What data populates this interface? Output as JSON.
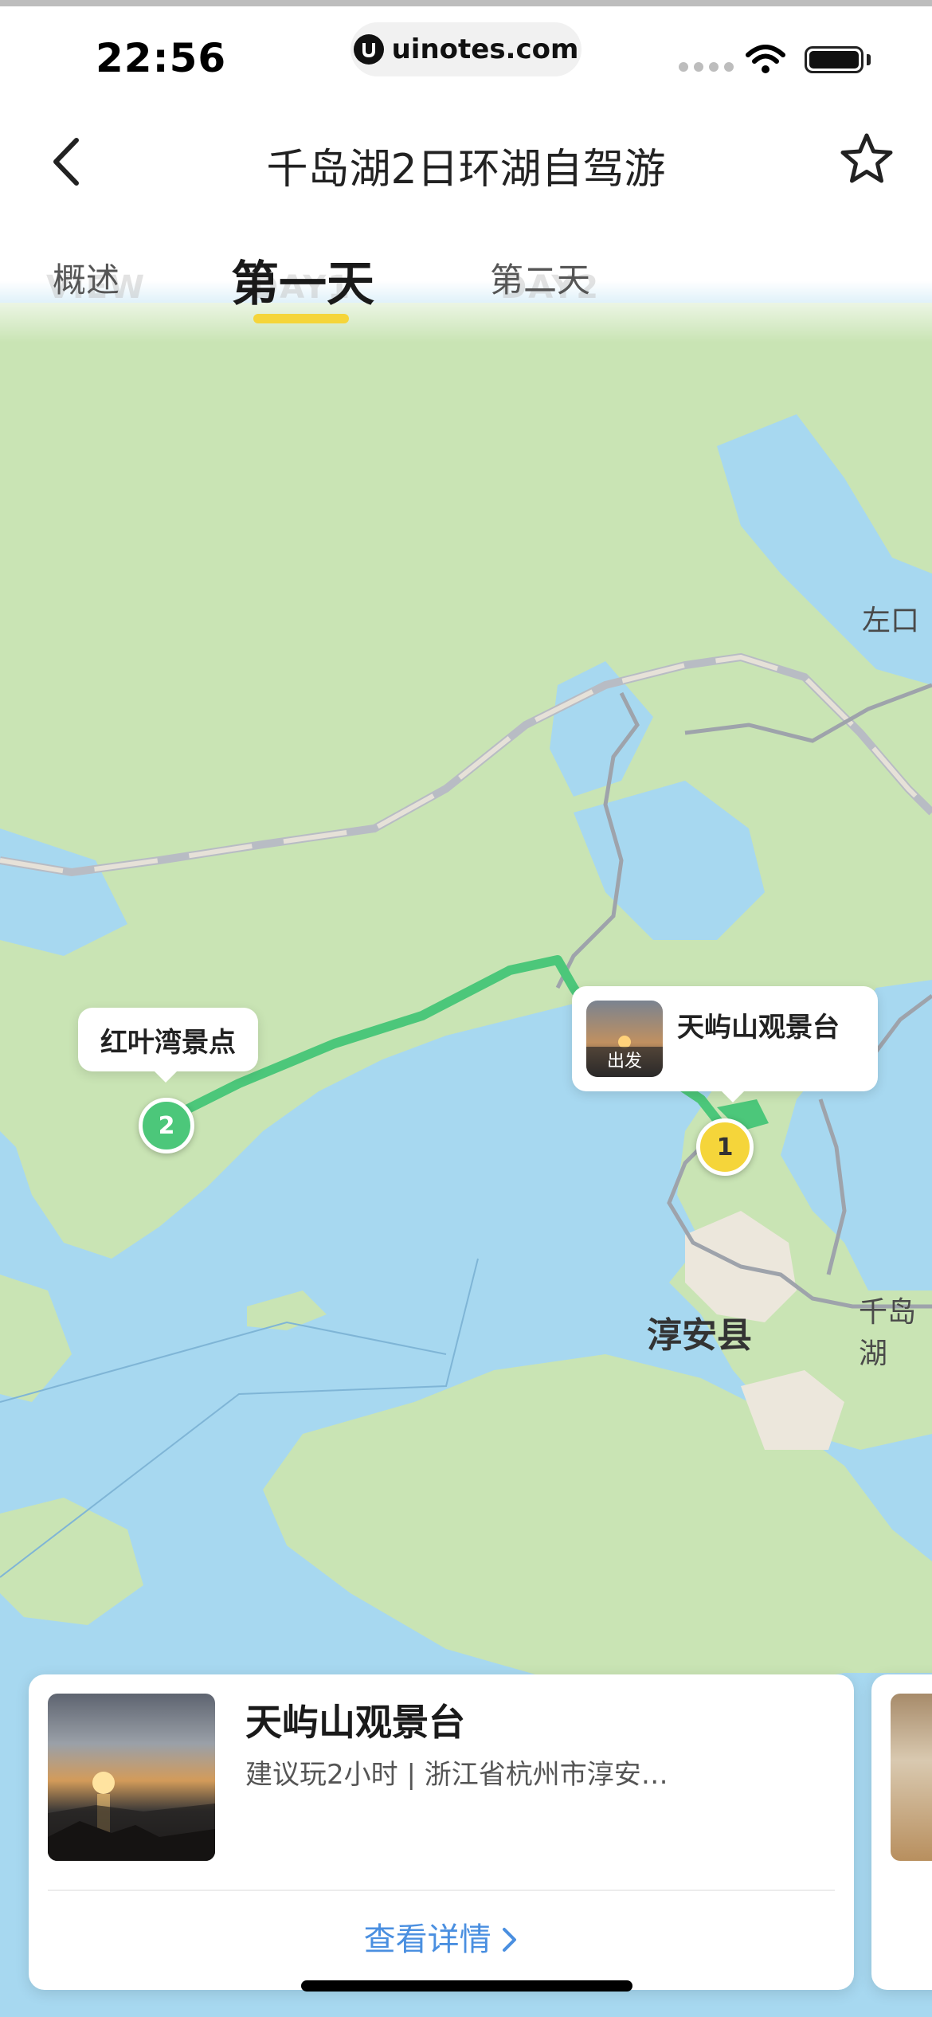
{
  "status_bar": {
    "time": "22:56",
    "url": "uinotes.com"
  },
  "header": {
    "title": "千岛湖2日环湖自驾游",
    "back_icon": "chevron-left-icon",
    "favorite_icon": "star-outline-icon"
  },
  "tabs": [
    {
      "label": "概述",
      "sub": "VIEW",
      "active": false
    },
    {
      "label": "第一天",
      "sub": "DAY1",
      "active": true
    },
    {
      "label": "第二天",
      "sub": "DAY2",
      "active": false
    }
  ],
  "accent_color": "#f5d53a",
  "route_color": "#4cc77a",
  "map": {
    "places": [
      "左口",
      "淳安县",
      "千岛湖"
    ],
    "markers": [
      {
        "number": "1",
        "name": "天屿山观景台",
        "badge": "出发"
      },
      {
        "number": "2",
        "name": "红叶湾景点"
      }
    ]
  },
  "card": {
    "title": "天屿山观景台",
    "subtitle": "建议玩2小时 | 浙江省杭州市淳安…",
    "detail_link": "查看详情",
    "detail_icon": "chevron-right-icon"
  }
}
